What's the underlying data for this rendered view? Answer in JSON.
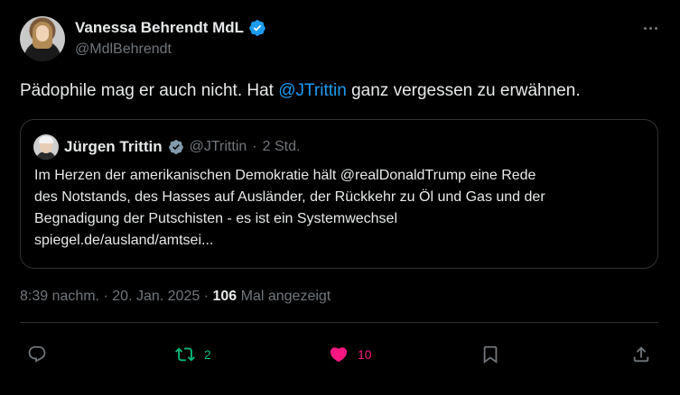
{
  "author": {
    "name": "Vanessa Behrendt MdL",
    "handle": "@MdlBehrendt"
  },
  "tweet": {
    "text_before": "Pädophile mag er auch nicht. Hat ",
    "mention": "@JTrittin",
    "text_after": " ganz vergessen zu erwähnen."
  },
  "quote": {
    "name": "Jürgen Trittin",
    "handle": "@JTrittin",
    "separator": "·",
    "time": "2 Std.",
    "lines": [
      "Im Herzen der amerikanischen Demokratie hält @realDonaldTrump eine Rede",
      "des Notstands, des Hasses auf Ausländer, der Rückkehr zu Öl und Gas und der",
      "Begnadigung der Putschisten - es ist ein Systemwechsel",
      "spiegel.de/ausland/amtsei..."
    ]
  },
  "meta": {
    "time": "8:39 nachm.",
    "sep1": " · ",
    "date": "20. Jan. 2025",
    "sep2": " · ",
    "views_count": "106",
    "views_label": " Mal angezeigt"
  },
  "actions": {
    "retweets": "2",
    "likes": "10"
  },
  "colors": {
    "background": "#000000",
    "text": "#e7e9ea",
    "secondary": "#71767b",
    "accent": "#1d9bf0",
    "retweet": "#00ba7c",
    "like": "#f91880"
  }
}
